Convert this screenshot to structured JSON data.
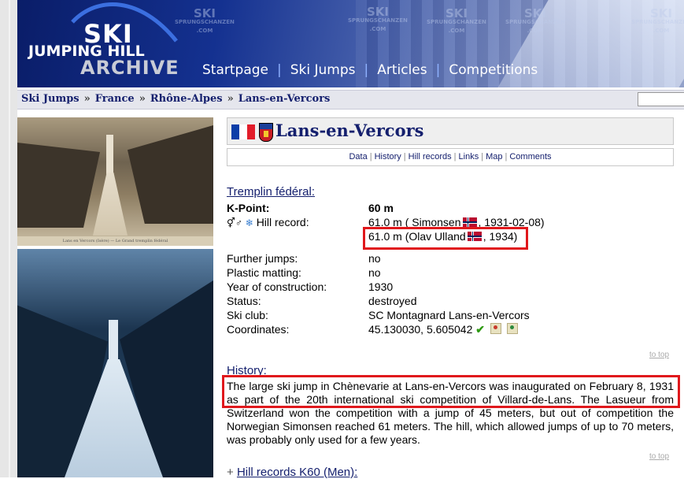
{
  "header": {
    "logo_line1": "SKI",
    "logo_line2": "JUMPING HILL",
    "logo_line3": "ARCHIVE",
    "watermark_main": "SKI",
    "watermark_sub": "SPRUNGSCHANZEN",
    "watermark_tld": ".COM",
    "nav": [
      "Startpage",
      "Ski Jumps",
      "Articles",
      "Competitions"
    ]
  },
  "breadcrumb": [
    "Ski Jumps",
    "France",
    "Rhône-Alpes",
    "Lans-en-Vercors"
  ],
  "photos": {
    "caption1": "Lans en Vercors (Isère) — Le Grand tremplin fédéral"
  },
  "page": {
    "title": "Lans-en-Vercors",
    "tabs": [
      "Data",
      "History",
      "Hill records",
      "Links",
      "Map",
      "Comments"
    ]
  },
  "hill": {
    "name": "Tremplin fédéral:",
    "kpoint_label": "K-Point:",
    "kpoint_value": "60 m",
    "hill_record_label": "Hill record:",
    "record1_pre": "61.0 m ( Simonsen",
    "record1_post": ", 1931-02-08)",
    "record2_pre": "61.0 m (Olav Ulland",
    "record2_post": ", 1934)",
    "details": [
      {
        "label": "Further jumps:",
        "value": "no"
      },
      {
        "label": "Plastic matting:",
        "value": "no"
      },
      {
        "label": "Year of construction:",
        "value": "1930"
      },
      {
        "label": "Status:",
        "value": "destroyed"
      },
      {
        "label": "Ski club:",
        "value": "SC Montagnard Lans-en-Vercors"
      },
      {
        "label": "Coordinates:",
        "value": "45.130030, 5.605042"
      }
    ],
    "coord_check": "✔"
  },
  "totop": "to top",
  "history": {
    "title": "History:",
    "text": "The large ski jump in Chènevarie at Lans-en-Vercors was inaugurated on February 8, 1931 as part of the 20th international ski competition of Villard-de-Lans. The Lasueur from Switzerland won the competition with a jump of 45 meters, but out of competition the Norwegian Simonsen reached 61 meters. The hill, which allowed jumps of up to 70 meters, was probably only used for a few years."
  },
  "records_section": {
    "expand": "+",
    "title": "Hill records K60 (Men):"
  },
  "colors": {
    "header_dark": "#0a1d68",
    "link": "#15206e",
    "nav_separator": "#8fb2ff",
    "highlight": "#e0181c"
  }
}
